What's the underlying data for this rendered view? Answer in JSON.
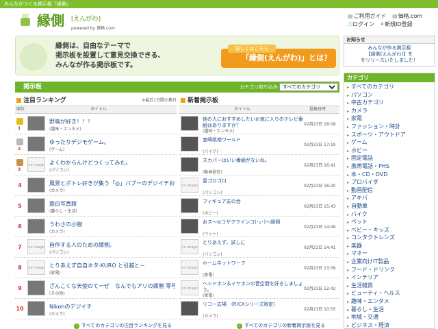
{
  "topbar": {
    "text": "みんながつくる掲示板「縁側」"
  },
  "logo": {
    "title": "縁側",
    "reading": "[えんがわ]",
    "powered": "powered by 価格.com"
  },
  "header_links": {
    "guide": "ご利用ガイド",
    "kakaku": "価格.com",
    "login": "ログイン",
    "register": "新規ID登録"
  },
  "banner": {
    "text_line1": "縁側は、自由なテーマで",
    "text_line2": "掲示板を設置して意見交換できる、",
    "text_line3": "みんなが作る掲示板です。",
    "button_tab": "詳しくはこちら",
    "button_label": "「縁側(えんがわ)」とは？"
  },
  "bbs_section": {
    "title": "掲示板",
    "filter_label": "カテゴリ絞り込み",
    "filter_value": "すべてのカテゴリ"
  },
  "ranking": {
    "title": "注目ランキング",
    "note": "※最近1日間の集計",
    "col_rank": "順位",
    "col_title": "タイトル",
    "rows": [
      {
        "rank": "1",
        "title": "野鳥が好き！！！",
        "cat": "(趣味・エンタメ)",
        "noimg": false
      },
      {
        "rank": "2",
        "title": "ゆったりデジモゲーム。",
        "cat": "(ゲーム)",
        "noimg": false
      },
      {
        "rank": "3",
        "title": "よくわからんけどつくってみた。",
        "cat": "(パソコン)",
        "noimg": true
      },
      {
        "rank": "4",
        "title": "風景とポトレ好きが集う「◎」バブーのデジイチお勉強スレ♪",
        "cat": "(カメラ)",
        "noimg": false
      },
      {
        "rank": "5",
        "title": "面白写真館",
        "cat": "(暮らし・生活)",
        "noimg": false
      },
      {
        "rank": "6",
        "title": "うわさの小物",
        "cat": "(カメラ)",
        "noimg": false
      },
      {
        "rank": "7",
        "title": "自作する人のための縁側。",
        "cat": "(パソコン)",
        "noimg": true
      },
      {
        "rank": "8",
        "title": "とりあえず自自ネタ-KURO と引越と－",
        "cat": "(家電)",
        "noimg": true
      },
      {
        "rank": "9",
        "title": "ざんこくな天使のてーぜ　なんでもアリの縁側 零号棟",
        "cat": "(その他)",
        "noimg": false
      },
      {
        "rank": "10",
        "title": "Nikonのデジイチ",
        "cat": "(カメラ)",
        "noimg": false
      }
    ],
    "more": "すべてのカテゴリの注目ランキングを見る"
  },
  "newest": {
    "title": "新着掲示板",
    "col_title": "タイトル",
    "col_date": "投稿日時",
    "rows": [
      {
        "title": "他の人におすすめしたいお気に入りのテレビ番組はありますか？",
        "cat": "(趣味・エンタメ)",
        "date": "02月23日 18:08",
        "noimg": false
      },
      {
        "title": "宮崎県南ワールド",
        "cat": "(バイク)",
        "date": "02月23日 17:19",
        "noimg": false
      },
      {
        "title": "スカパーはいい番組がないね。",
        "cat": "(動画配信)",
        "date": "02月23日 16:41",
        "noimg": false
      },
      {
        "title": "雷ゴロゴロ",
        "cat": "(パソコン)",
        "date": "02月23日 16:20",
        "noimg": true
      },
      {
        "title": "フィギュア友の会",
        "cat": "(ホビー)",
        "date": "02月23日 15:43",
        "noimg": false
      },
      {
        "title": "おス～◎コザクラインコ(･ｪ･)～縁側",
        "cat": "(ペット)",
        "date": "02月23日 14:49",
        "noimg": false
      },
      {
        "title": "とりあえず、試しに",
        "cat": "(パソコン)",
        "date": "02月23日 14:41",
        "noimg": true
      },
      {
        "title": "ホームネットワーク",
        "cat": "(家電)",
        "date": "02月23日 13:39",
        "noimg": true
      },
      {
        "title": "ヘッドホン＆イヤホンの音空間を好きしましょう。",
        "cat": "(家電)",
        "date": "02月23日 12:42",
        "noimg": true
      },
      {
        "title": "リコー広場　(R/CXシリーズ限定)",
        "cat": "(カメラ)",
        "date": "02月23日 10:55",
        "noimg": false
      }
    ],
    "more": "すべてのカテゴリの新着掲示板を見る"
  },
  "notice": {
    "title": "お知らせ",
    "line1": "みんなが作る掲示板",
    "line2": "【縁側(えんがわ)】を",
    "line3": "をリリースいたしました！"
  },
  "categories": {
    "title": "カテゴリ",
    "items": [
      "すべてのカテゴリ",
      "パソコン",
      "中古カテゴリ",
      "カメラ",
      "家電",
      "ファッション・時計",
      "スポーツ・アウトドア",
      "ゲーム",
      "ホビー",
      "固定電話",
      "携帯電話・PHS",
      "本・CD・DVD",
      "プロバイダ",
      "動画配信",
      "アキバ",
      "自動車",
      "バイク",
      "ペット",
      "ベビー・キッズ",
      "コンタクトレンズ",
      "楽器",
      "マネー",
      "企業向けIT製品",
      "フード・ドリンク",
      "インテリア",
      "生活雑貨",
      "ビューティ・ヘルス",
      "趣味・エンタメ",
      "暮らし・生活",
      "地域・交通",
      "ビジネス・経済"
    ]
  },
  "colors": {
    "accent": "#6eb42a",
    "orange": "#f29a1d",
    "link": "#1a4a8a",
    "rank": "#c33333"
  }
}
